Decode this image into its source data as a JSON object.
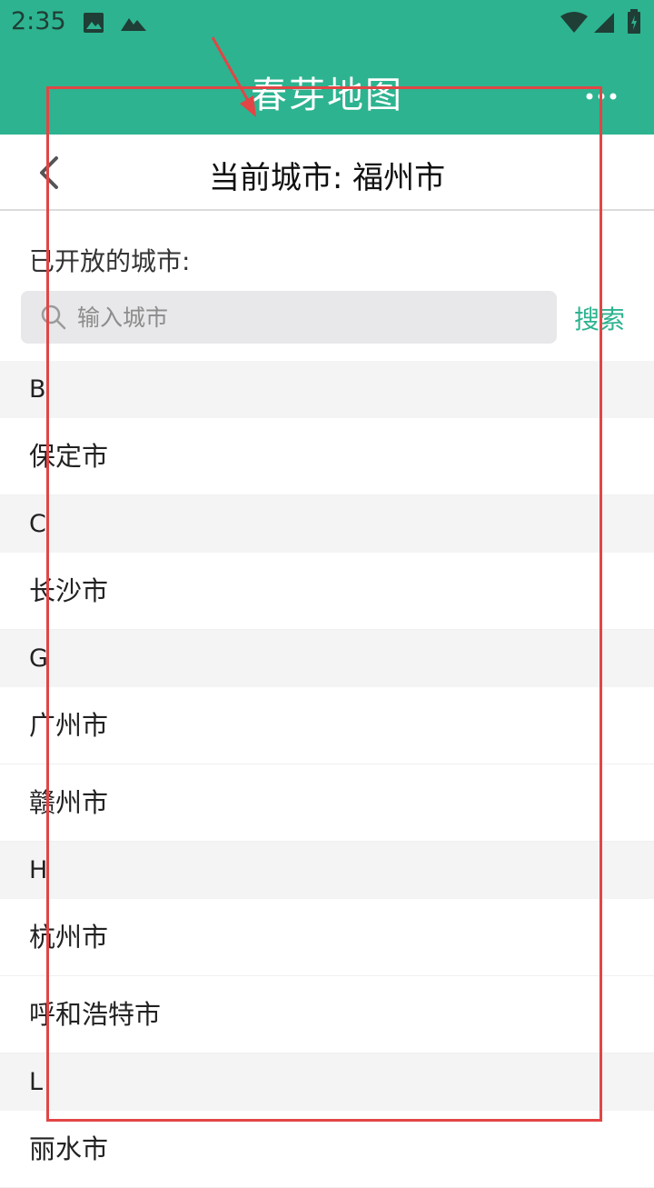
{
  "status_bar": {
    "time": "2:35",
    "icons": [
      "image-icon",
      "mountain-icon",
      "wifi-icon",
      "signal-icon",
      "battery-icon"
    ]
  },
  "app_bar": {
    "title": "春芽地图",
    "menu_icon": "more-horizontal-icon"
  },
  "nav": {
    "back_icon": "chevron-left-icon",
    "title": "当前城市: 福州市"
  },
  "cities_section": {
    "label": "已开放的城市:"
  },
  "search": {
    "placeholder": "输入城市",
    "value": "",
    "button_label": "搜索",
    "icon": "search-icon"
  },
  "groups": [
    {
      "letter": "B",
      "cities": [
        "保定市"
      ]
    },
    {
      "letter": "C",
      "cities": [
        "长沙市"
      ]
    },
    {
      "letter": "G",
      "cities": [
        "广州市",
        "赣州市"
      ]
    },
    {
      "letter": "H",
      "cities": [
        "杭州市",
        "呼和浩特市"
      ]
    },
    {
      "letter": "L",
      "cities": [
        "丽水市"
      ]
    }
  ],
  "colors": {
    "primary": "#2db390",
    "annotation": "#e24545",
    "section_bg": "#f4f4f5"
  }
}
